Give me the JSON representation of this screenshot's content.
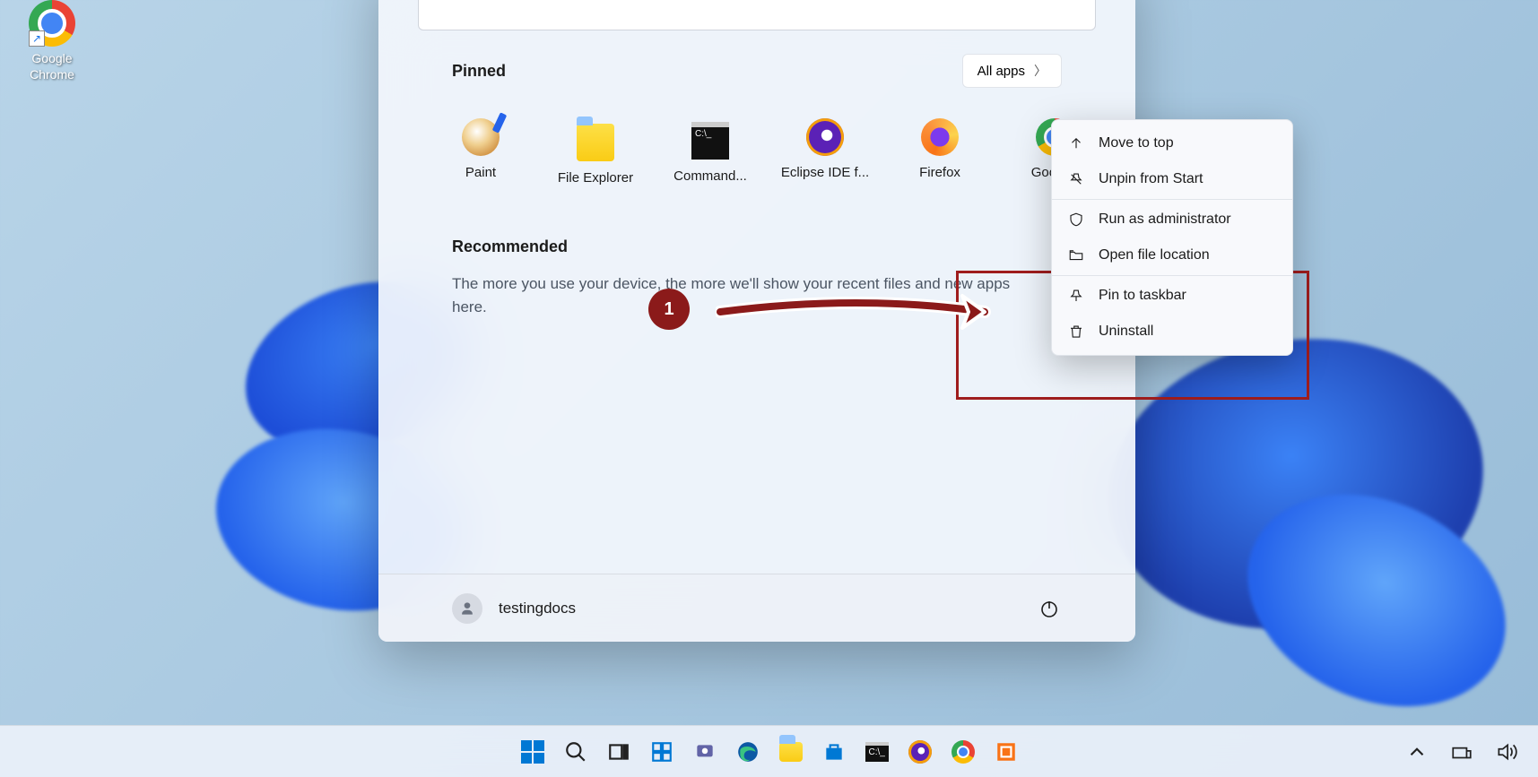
{
  "desktop": {
    "icons": [
      {
        "name": "Google\nChrome"
      }
    ]
  },
  "start_menu": {
    "pinned_label": "Pinned",
    "all_apps_label": "All apps",
    "pinned_apps": [
      {
        "name": "Paint"
      },
      {
        "name": "File Explorer"
      },
      {
        "name": "Command..."
      },
      {
        "name": "Eclipse IDE f..."
      },
      {
        "name": "Firefox"
      },
      {
        "name": "Googl..."
      }
    ],
    "recommended_label": "Recommended",
    "recommended_hint": "The more you use your device, the more we'll show your recent files and new apps here.",
    "user_name": "testingdocs"
  },
  "context_menu": {
    "items": [
      {
        "label": "Move to top",
        "icon": "arrow-up"
      },
      {
        "label": "Unpin from Start",
        "icon": "unpin"
      }
    ],
    "items2": [
      {
        "label": "Run as administrator",
        "icon": "shield"
      },
      {
        "label": "Open file location",
        "icon": "folder-open"
      }
    ],
    "items3": [
      {
        "label": "Pin to taskbar",
        "icon": "pin"
      },
      {
        "label": "Uninstall",
        "icon": "trash"
      }
    ]
  },
  "annotation": {
    "badge": "1"
  },
  "colors": {
    "annotation_red": "#8b1a1a"
  }
}
